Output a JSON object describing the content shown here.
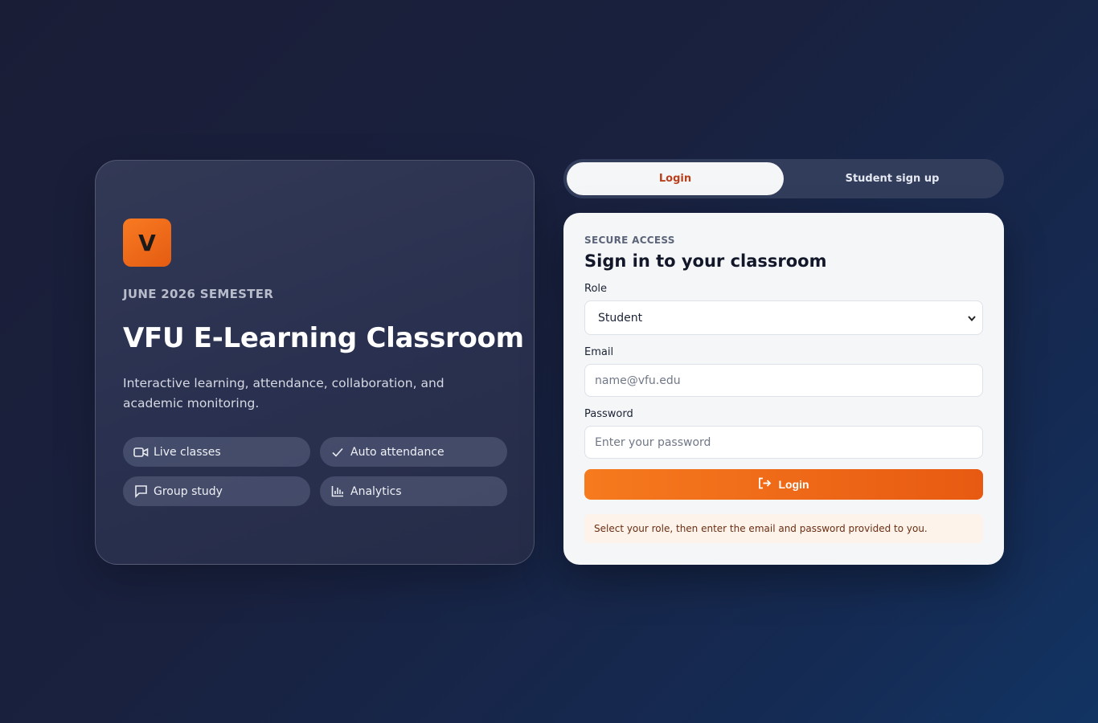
{
  "hero": {
    "logo_letter": "V",
    "eyebrow": "JUNE 2026 SEMESTER",
    "title": "VFU E-Learning Classroom",
    "description": "Interactive learning, attendance, collaboration, and academic monitoring.",
    "features": [
      {
        "label": "Live classes",
        "icon": "video-icon"
      },
      {
        "label": "Auto attendance",
        "icon": "check-icon"
      },
      {
        "label": "Group study",
        "icon": "chat-bubble-icon"
      },
      {
        "label": "Analytics",
        "icon": "bar-chart-icon"
      }
    ]
  },
  "tabs": {
    "login": "Login",
    "signup": "Student sign up",
    "active": "login"
  },
  "form": {
    "eyebrow": "SECURE ACCESS",
    "title": "Sign in to your classroom",
    "role_label": "Role",
    "role_value": "Student",
    "email_label": "Email",
    "email_placeholder": "name@vfu.edu",
    "password_label": "Password",
    "password_placeholder": "Enter your password",
    "submit_label": "Login",
    "hint": "Select your role, then enter the email and password provided to you."
  },
  "colors": {
    "accent": "#f0661a",
    "tab_active_text": "#b8401c",
    "background": "#1a1d36"
  }
}
